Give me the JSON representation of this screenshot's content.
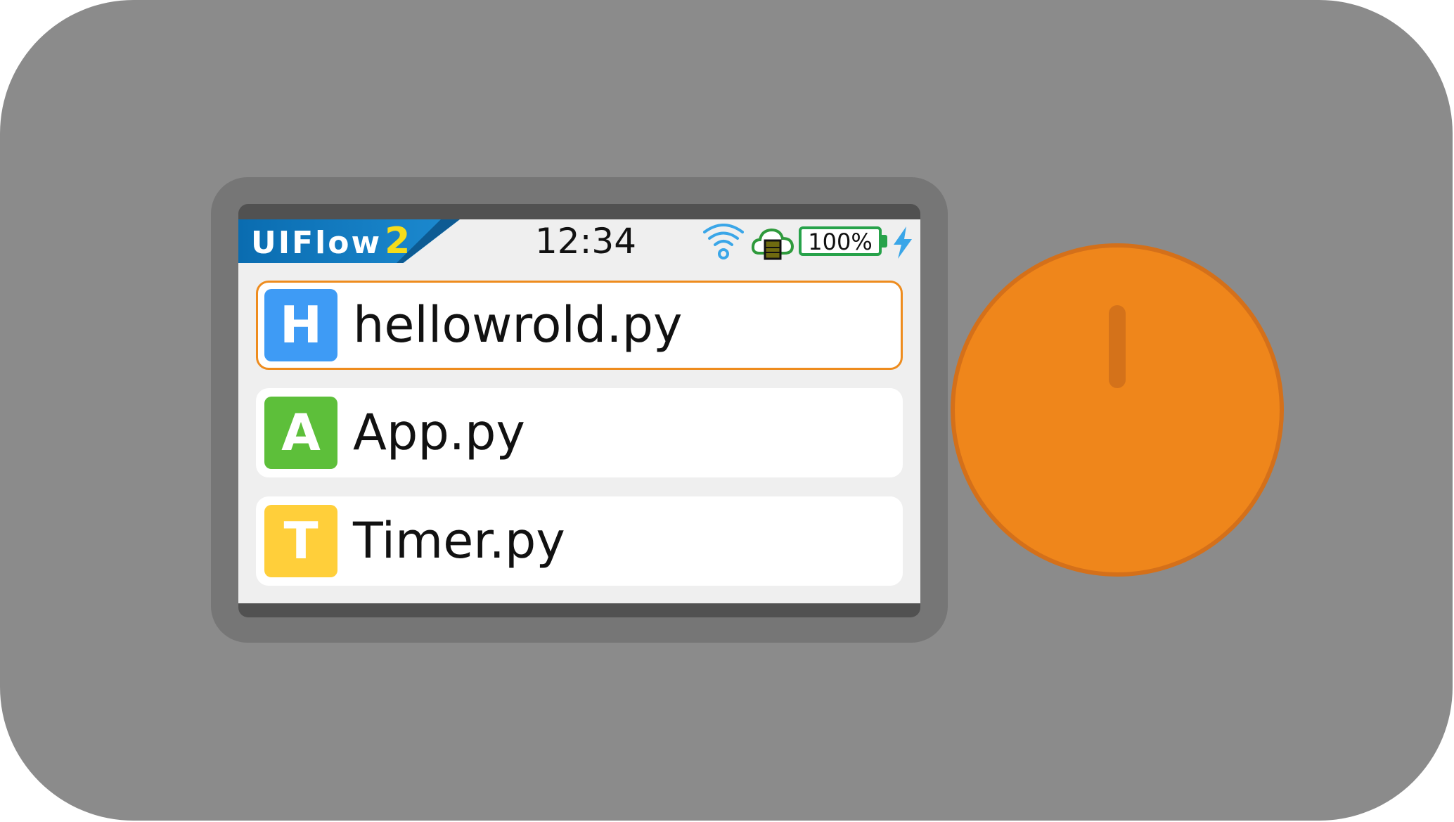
{
  "status_bar": {
    "logo": {
      "text": "UIFlow",
      "version": "2"
    },
    "time": "12:34",
    "wifi_icon": "wifi-icon",
    "cloud_icon": "cloud-sd-icon",
    "battery": {
      "label": "100%",
      "level": 1.0
    },
    "charging_icon": "lightning-bolt-icon"
  },
  "files": [
    {
      "letter": "H",
      "name": "hellowrold.py",
      "color": "#3e9bf5",
      "selected": true
    },
    {
      "letter": "A",
      "name": "App.py",
      "color": "#5dbf3a",
      "selected": false
    },
    {
      "letter": "T",
      "name": "Timer.py",
      "color": "#ffcf3a",
      "selected": false
    }
  ],
  "colors": {
    "device_body": "#8b8b8b",
    "selection_border": "#ee8c1e",
    "knob": "#ef861b",
    "battery": "#27a24a",
    "bolt": "#3aa6e8"
  },
  "hardware": {
    "knob_icon": "rotary-knob"
  }
}
